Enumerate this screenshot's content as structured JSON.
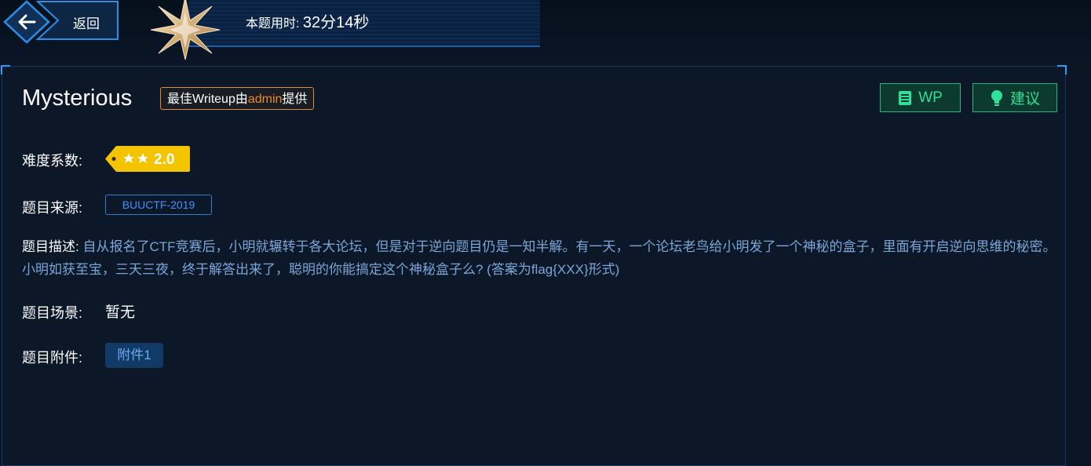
{
  "header": {
    "back_label": "返回",
    "timer_label": "本题用时: ",
    "timer_value": "32分14秒"
  },
  "challenge": {
    "title": "Mysterious",
    "best_writeup_prefix": "最佳Writeup由",
    "best_writeup_author": "admin",
    "best_writeup_suffix": "提供",
    "wp_button": "WP",
    "suggest_button": "建议",
    "difficulty_label": "难度系数:",
    "difficulty_value": "2.0",
    "difficulty_stars": 2,
    "source_label": "题目来源:",
    "source_value": "BUUCTF-2019",
    "description_label": "题目描述:",
    "description_text": "自从报名了CTF竞赛后，小明就辗转于各大论坛，但是对于逆向题目仍是一知半解。有一天，一个论坛老鸟给小明发了一个神秘的盒子，里面有开启逆向思维的秘密。小明如获至宝，三天三夜，终于解答出来了，聪明的你能搞定这个神秘盒子么? (答案为flag{XXX}形式)",
    "scene_label": "题目场景:",
    "scene_value": "暂无",
    "attachment_label": "题目附件:",
    "attachment_button": "附件1"
  },
  "colors": {
    "background": "#0b1524",
    "accent_blue": "#1ea0ff",
    "accent_green": "#2ee09a",
    "badge_orange": "#f08a2a",
    "difficulty_yellow": "#f5c400",
    "description_text": "#7ba6d8"
  },
  "icons": [
    "back-arrow-icon",
    "star-badge-icon",
    "book-icon",
    "lightbulb-icon",
    "star-icon"
  ]
}
